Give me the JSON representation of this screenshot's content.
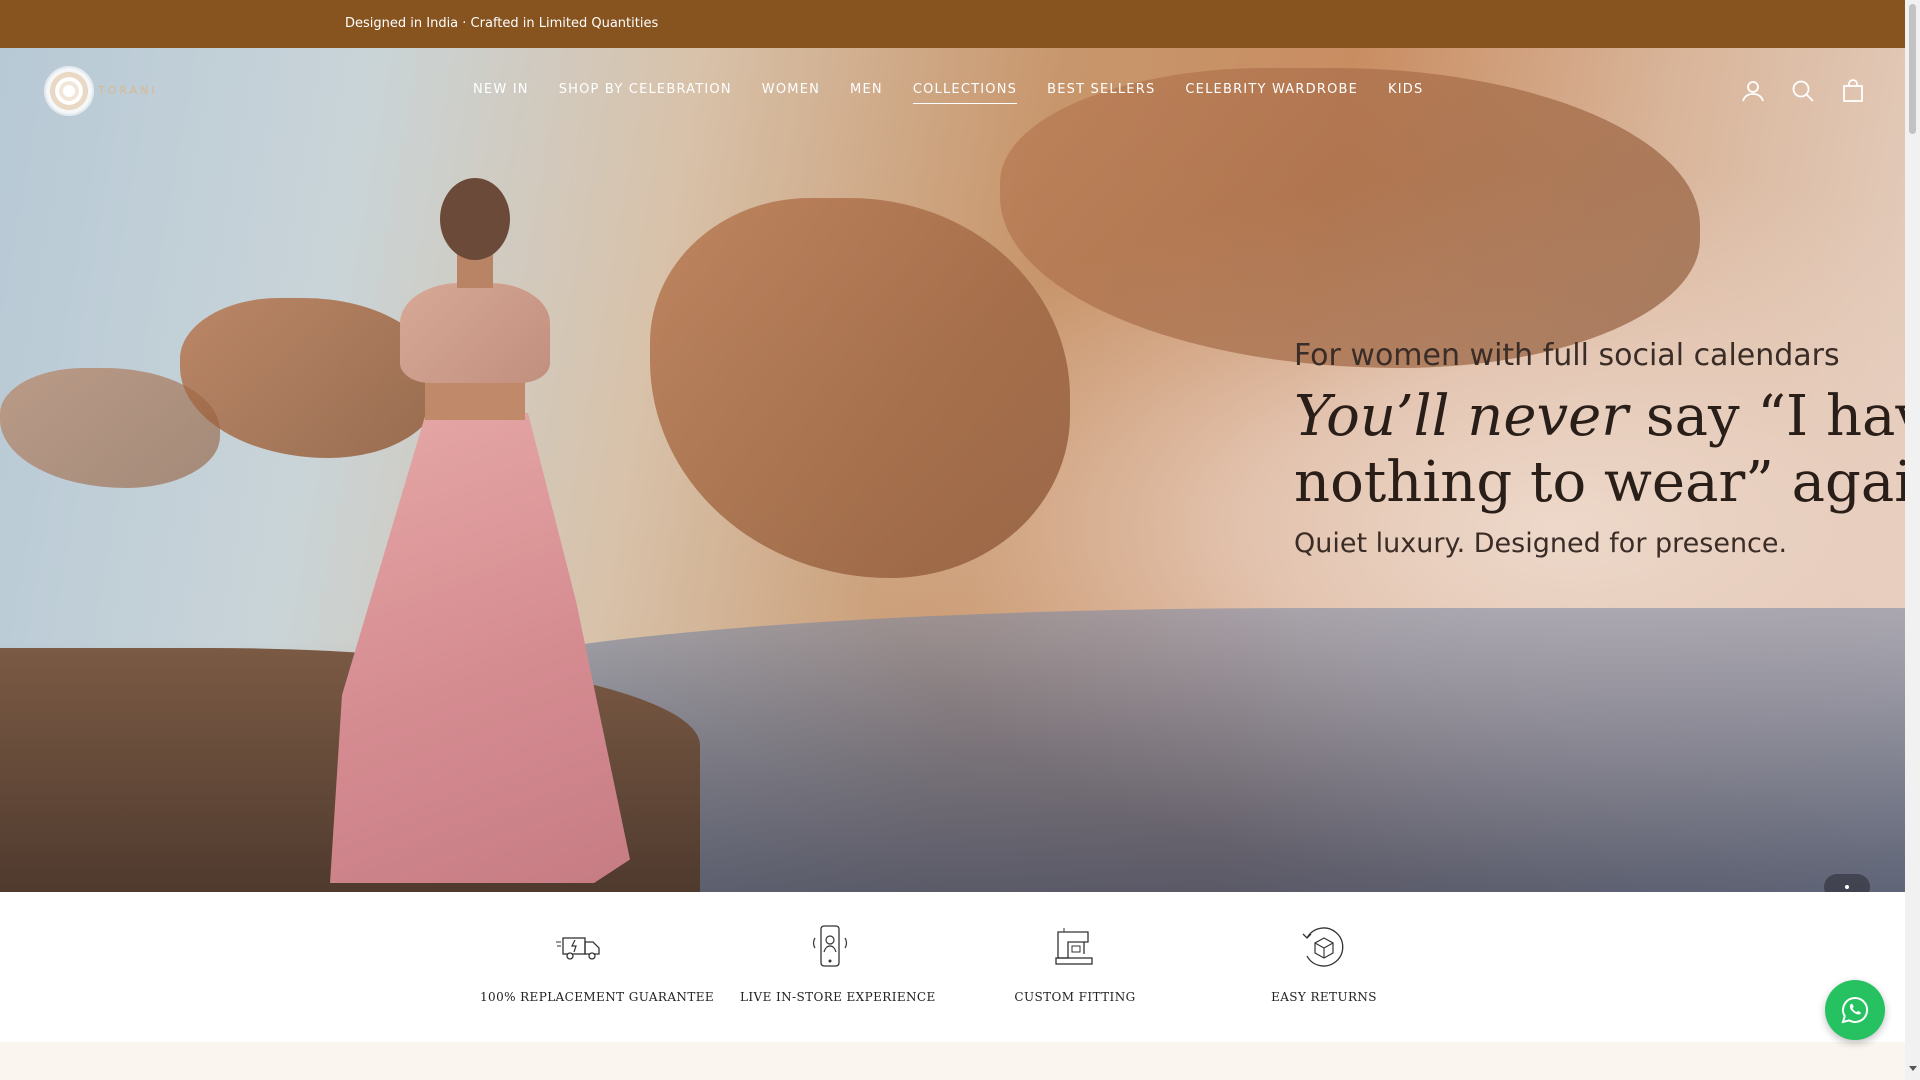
{
  "announcement": {
    "text": "Designed in India · Crafted in Limited Quantities"
  },
  "brand": {
    "logo_text": "TORANI"
  },
  "nav": {
    "items": [
      {
        "label": "NEW IN"
      },
      {
        "label": "SHOP BY CELEBRATION"
      },
      {
        "label": "WOMEN"
      },
      {
        "label": "MEN"
      },
      {
        "label": "COLLECTIONS",
        "active": true
      },
      {
        "label": "BEST SELLERS"
      },
      {
        "label": "CELEBRITY WARDROBE"
      },
      {
        "label": "KIDS"
      }
    ]
  },
  "header_icons": [
    "account-icon",
    "search-icon",
    "cart-icon"
  ],
  "hero": {
    "subtitle": "For women with full social calendars",
    "title_line1_italic": "You’ll never",
    "title_line1_rest": " say “I have",
    "title_line2": "nothing to wear” again.",
    "tagline": "Quiet luxury. Designed for presence."
  },
  "features": [
    {
      "label": "100% REPLACEMENT GUARANTEE",
      "icon": "delivery-truck-icon"
    },
    {
      "label": "LIVE IN-STORE EXPERIENCE",
      "icon": "video-call-phone-icon"
    },
    {
      "label": "CUSTOM FITTING",
      "icon": "sewing-machine-icon"
    },
    {
      "label": "EASY RETURNS",
      "icon": "return-box-icon"
    }
  ],
  "colors": {
    "announcement_bg": "#87531f",
    "whatsapp": "#26c161"
  }
}
